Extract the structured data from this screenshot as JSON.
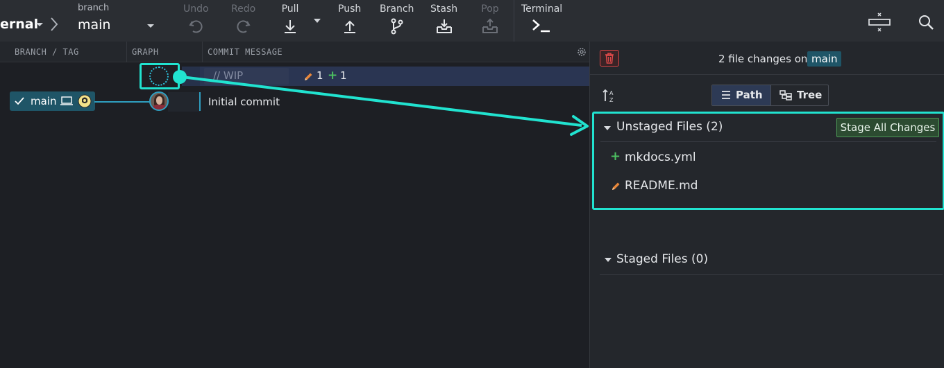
{
  "toolbar": {
    "repo_name": "ernal",
    "branch_caption": "branch",
    "branch_value": "main",
    "buttons": {
      "undo": "Undo",
      "redo": "Redo",
      "pull": "Pull",
      "push": "Push",
      "branch": "Branch",
      "stash": "Stash",
      "pop": "Pop",
      "terminal": "Terminal"
    },
    "icons": [
      "undo-icon",
      "redo-icon",
      "pull-icon",
      "push-icon",
      "branch-icon",
      "stash-icon",
      "pop-icon",
      "terminal-icon",
      "layout-toggle-icon",
      "search-icon"
    ]
  },
  "graph": {
    "columns": [
      "BRANCH / TAG",
      "GRAPH",
      "COMMIT MESSAGE"
    ],
    "wip": {
      "placeholder": "// WIP",
      "modified_count": "1",
      "added_count": "1"
    },
    "commits": [
      {
        "branch_label": "main",
        "message": "Initial commit"
      }
    ]
  },
  "panel": {
    "changes_text": "2 file changes on",
    "branch": "main",
    "view_modes": [
      "Path",
      "Tree"
    ],
    "active_view": "Path",
    "unstaged": {
      "title": "Unstaged Files (2)",
      "stage_all_label": "Stage All Changes",
      "files": [
        {
          "name": "mkdocs.yml",
          "status": "added"
        },
        {
          "name": "README.md",
          "status": "modified"
        }
      ]
    },
    "staged": {
      "title": "Staged Files (0)"
    }
  },
  "colors": {
    "accent_highlight": "#21e3d0",
    "branch_blue": "#2f9fc1",
    "added_green": "#4cc061",
    "modified_orange": "#e8873a",
    "discard_red": "#d84545"
  }
}
